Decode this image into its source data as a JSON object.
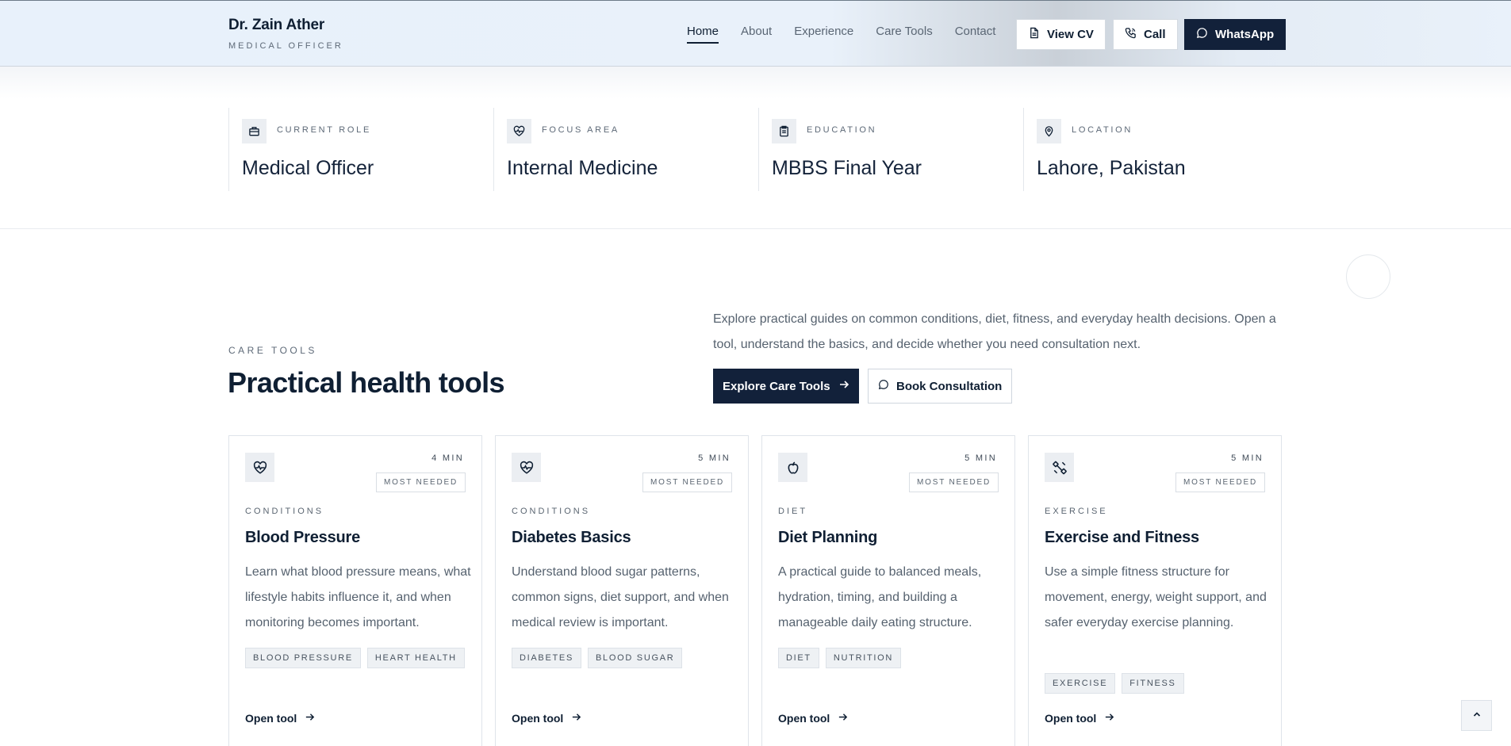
{
  "brand": {
    "name": "Dr. Zain Ather",
    "subtitle": "MEDICAL OFFICER"
  },
  "nav": {
    "items": [
      {
        "label": "Home",
        "active": true
      },
      {
        "label": "About",
        "active": false
      },
      {
        "label": "Experience",
        "active": false
      },
      {
        "label": "Care Tools",
        "active": false
      },
      {
        "label": "Contact",
        "active": false
      }
    ]
  },
  "header_buttons": {
    "view_cv": {
      "label": "View CV",
      "icon": "document-icon"
    },
    "call": {
      "label": "Call",
      "icon": "phone-icon"
    },
    "whatsapp": {
      "label": "WhatsApp",
      "icon": "chat-icon"
    }
  },
  "stats": [
    {
      "label": "CURRENT ROLE",
      "value": "Medical Officer",
      "icon": "briefcase-icon"
    },
    {
      "label": "FOCUS AREA",
      "value": "Internal Medicine",
      "icon": "heartbeat-icon"
    },
    {
      "label": "EDUCATION",
      "value": "MBBS Final Year",
      "icon": "clipboard-icon"
    },
    {
      "label": "LOCATION",
      "value": "Lahore, Pakistan",
      "icon": "map-pin-icon"
    }
  ],
  "care_tools": {
    "eyebrow": "CARE TOOLS",
    "title": "Practical health tools",
    "intro": "Explore practical guides on common conditions, diet, fitness, and everyday health decisions. Open a tool, understand the basics, and decide whether you need consultation next.",
    "primary_button": "Explore Care Tools",
    "secondary_button": "Book Consultation",
    "cards": [
      {
        "icon": "heartbeat-icon",
        "time": "4 MIN",
        "badge": "MOST NEEDED",
        "category": "CONDITIONS",
        "title": "Blood Pressure",
        "description": "Learn what blood pressure means, what lifestyle habits influence it, and when monitoring becomes important.",
        "tags": [
          "BLOOD PRESSURE",
          "HEART HEALTH"
        ],
        "link": "Open tool"
      },
      {
        "icon": "heartbeat-icon",
        "time": "5 MIN",
        "badge": "MOST NEEDED",
        "category": "CONDITIONS",
        "title": "Diabetes Basics",
        "description": "Understand blood sugar patterns, common signs, diet support, and when medical review is important.",
        "tags": [
          "DIABETES",
          "BLOOD SUGAR"
        ],
        "link": "Open tool"
      },
      {
        "icon": "apple-icon",
        "time": "5 MIN",
        "badge": "MOST NEEDED",
        "category": "DIET",
        "title": "Diet Planning",
        "description": "A practical guide to balanced meals, hydration, timing, and building a manageable daily eating structure.",
        "tags": [
          "DIET",
          "NUTRITION"
        ],
        "link": "Open tool"
      },
      {
        "icon": "dumbbell-icon",
        "time": "5 MIN",
        "badge": "MOST NEEDED",
        "category": "EXERCISE",
        "title": "Exercise and Fitness",
        "description": "Use a simple fitness structure for movement, energy, weight support, and safer everyday exercise planning.",
        "tags": [
          "EXERCISE",
          "FITNESS"
        ],
        "link": "Open tool"
      }
    ]
  }
}
